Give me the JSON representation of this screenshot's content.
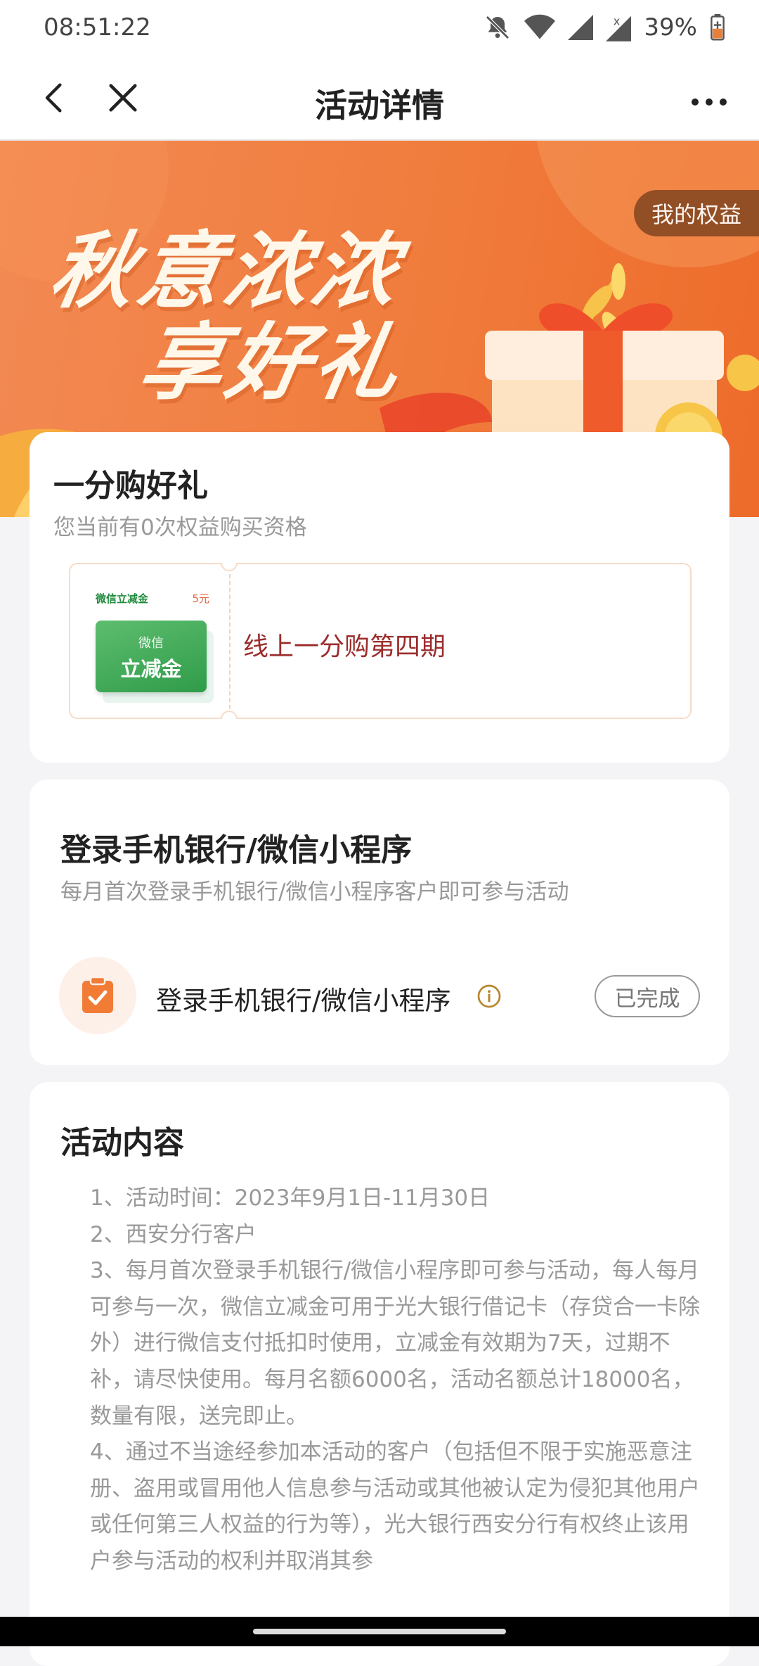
{
  "status_bar": {
    "time": "08:51:22",
    "battery": "39%"
  },
  "nav": {
    "title": "活动详情"
  },
  "banner": {
    "title_line1": "秋意浓浓",
    "title_line2": "享好礼",
    "my_rights": "我的权益"
  },
  "offer_card": {
    "title": "一分购好礼",
    "subtitle": "您当前有0次权益购买资格",
    "coupon": {
      "name": "微信立减金",
      "value": "5元",
      "badge_line1": "微信",
      "badge_line2": "立减金",
      "title": "线上一分购第四期"
    }
  },
  "task_card": {
    "title": "登录手机银行/微信小程序",
    "subtitle": "每月首次登录手机银行/微信小程序客户即可参与活动",
    "task_label": "登录手机银行/微信小程序",
    "status": "已完成"
  },
  "content_card": {
    "title": "活动内容",
    "items": [
      "1、活动时间：2023年9月1日-11月30日",
      "2、西安分行客户",
      "3、每月首次登录手机银行/微信小程序即可参与活动，每人每月可参与一次，微信立减金可用于光大银行借记卡（存贷合一卡除外）进行微信支付抵扣时使用，立减金有效期为7天，过期不补，请尽快使用。每月名额6000名，活动名额总计18000名，数量有限，送完即止。",
      "4、通过不当途经参加本活动的客户（包括但不限于实施恶意注册、盗用或冒用他人信息参与活动或其他被认定为侵犯其他用户或任何第三人权益的行为等），光大银行西安分行有权终止该用户参与活动的权利并取消其参"
    ]
  },
  "colors": {
    "brand": "#f07c3c",
    "coupon_green": "#2f9c49",
    "coupon_title": "#9b2d2d"
  }
}
